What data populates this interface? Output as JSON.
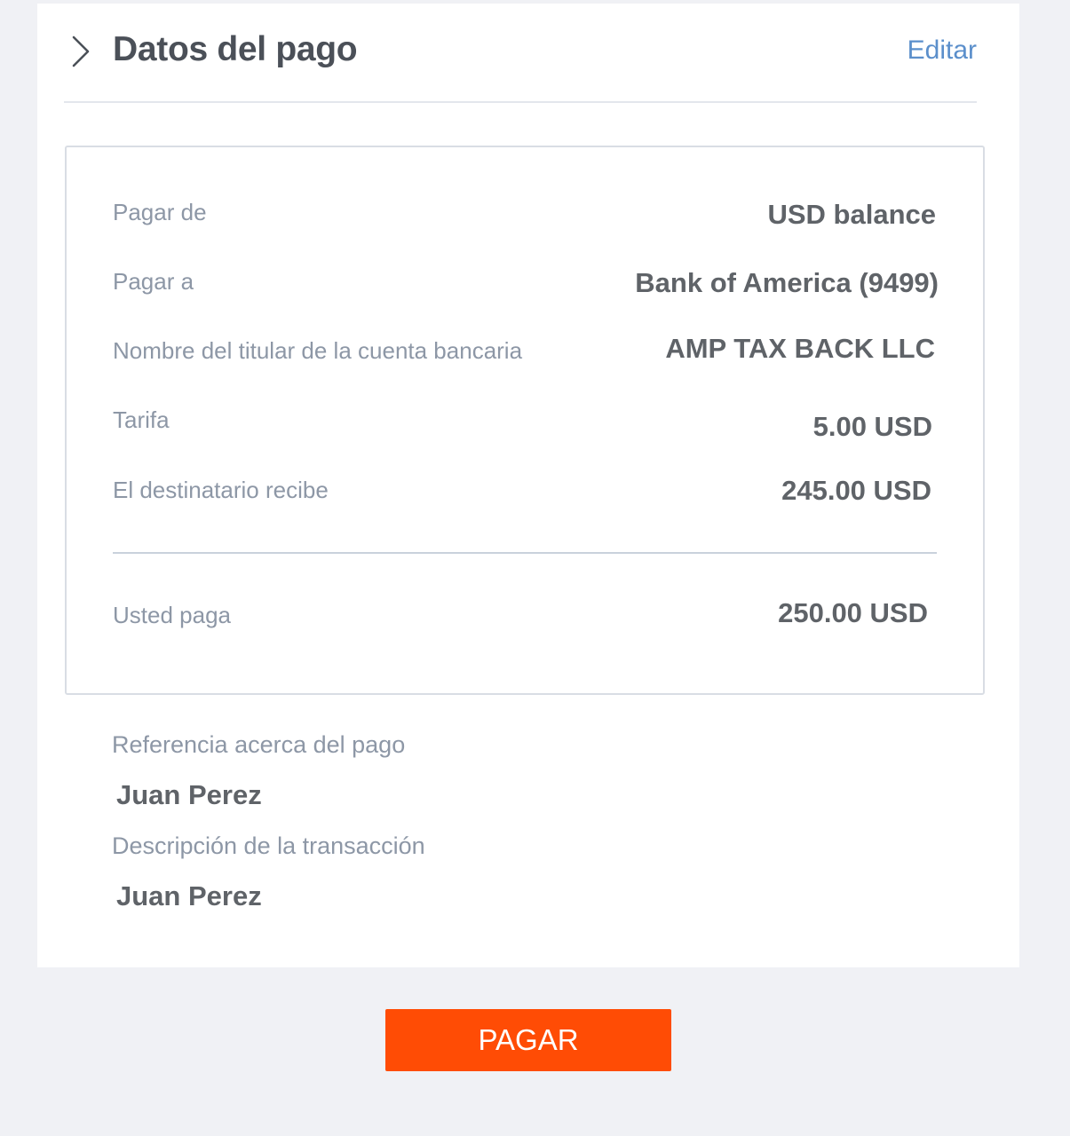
{
  "colors": {
    "page_background": "#f0f1f5",
    "card_background": "#ffffff",
    "title_text": "#4b5058",
    "label_text": "#8d97a6",
    "value_text": "#5f6368",
    "link": "#5b8fcb",
    "primary_button": "#ff4c05",
    "button_text": "#ffffff"
  },
  "header": {
    "icon": "chevron-right-icon",
    "title": "Datos del pago",
    "edit_label": "Editar"
  },
  "summary": {
    "rows": [
      {
        "label": "Pagar de",
        "value": "USD balance"
      },
      {
        "label": "Pagar a",
        "value": "Bank of America (9499)"
      },
      {
        "label": "Nombre del titular de la cuenta bancaria",
        "value": "AMP TAX BACK LLC"
      },
      {
        "label": "Tarifa",
        "value": "5.00 USD"
      },
      {
        "label": "El destinatario recibe",
        "value": "245.00 USD"
      }
    ],
    "total": {
      "label": "Usted paga",
      "value": "250.00 USD"
    }
  },
  "details": {
    "reference": {
      "label": "Referencia acerca del pago",
      "value": "Juan Perez"
    },
    "description": {
      "label": "Descripción de la transacción",
      "value": "Juan Perez"
    }
  },
  "actions": {
    "pay_label": "PAGAR"
  }
}
